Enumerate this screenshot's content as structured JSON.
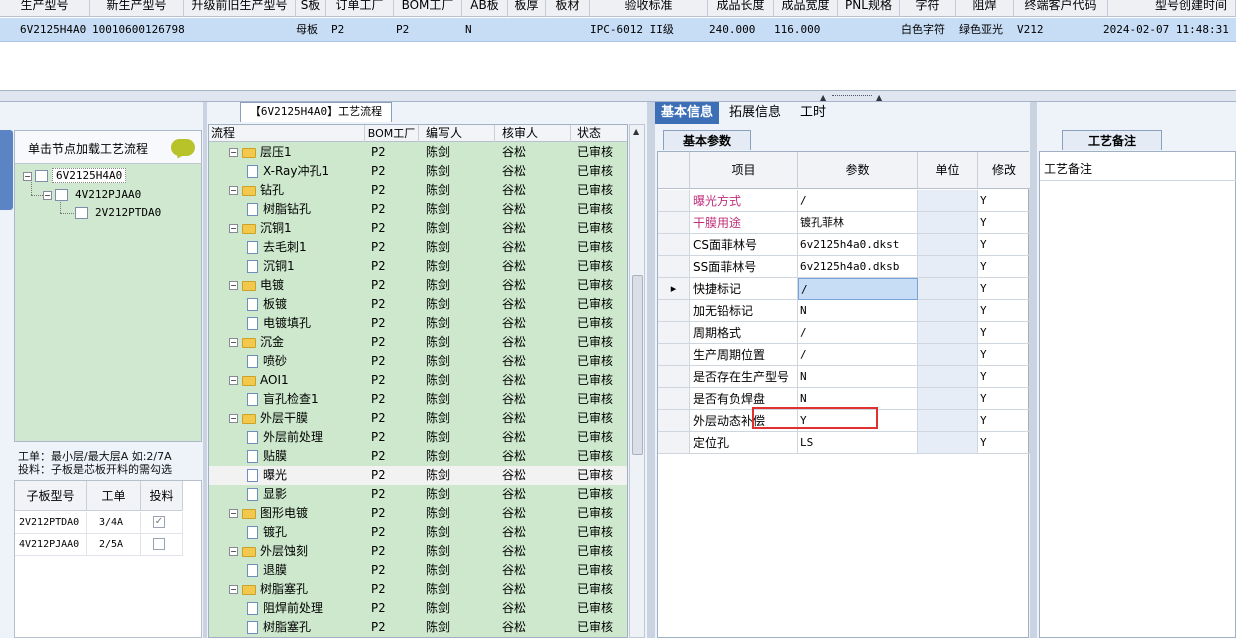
{
  "top_grid": {
    "headers": [
      "生产型号",
      "新生产型号",
      "升级前旧生产型号",
      "S板",
      "订单工厂",
      "BOM工厂",
      "AB板",
      "板厚",
      "板材",
      "验收标准",
      "成品长度",
      "成品宽度",
      "PNL规格",
      "字符",
      "阻焊",
      "终端客户代码",
      "型号创建时间"
    ],
    "row": {
      "prod_model": "6V2125H4A0",
      "new_model": "10010600126798",
      "board_type": "母板",
      "order_factory": "P2",
      "bom_factory": "P2",
      "ab": "N",
      "standard": "IPC-6012 II级",
      "length": "240.000",
      "width": "116.000",
      "char": "白色字符",
      "solder": "绿色亚光",
      "client_code": "V212",
      "created": "2024-02-07 11:48:31"
    }
  },
  "left": {
    "tree_header": "单击节点加载工艺流程",
    "tree": [
      "6V2125H4A0",
      "4V212PJAA0",
      "2V212PTDA0"
    ],
    "note_line1": "工单：最小层/最大层A 如:2/7A",
    "note_line2": "投料：子板是芯板开料的需勾选",
    "sub_headers": [
      "子板型号",
      "工单",
      "投料"
    ],
    "sub_rows": [
      {
        "model": "2V212PTDA0",
        "order": "3/4A",
        "checked": "✓"
      },
      {
        "model": "4V212PJAA0",
        "order": "2/5A",
        "checked": ""
      }
    ]
  },
  "center": {
    "title": "【6V2125H4A0】工艺流程",
    "headers": [
      "流程",
      "BOM工厂",
      "编写人",
      "核审人",
      "状态"
    ],
    "rows": [
      {
        "name": "层压1",
        "level": 0,
        "f": "P2",
        "w": "陈剑",
        "r": "谷松",
        "s": "已审核"
      },
      {
        "name": "X-Ray冲孔1",
        "level": 1,
        "f": "P2",
        "w": "陈剑",
        "r": "谷松",
        "s": "已审核"
      },
      {
        "name": "钻孔",
        "level": 0,
        "f": "P2",
        "w": "陈剑",
        "r": "谷松",
        "s": "已审核"
      },
      {
        "name": "树脂钻孔",
        "level": 1,
        "f": "P2",
        "w": "陈剑",
        "r": "谷松",
        "s": "已审核"
      },
      {
        "name": "沉铜1",
        "level": 0,
        "f": "P2",
        "w": "陈剑",
        "r": "谷松",
        "s": "已审核"
      },
      {
        "name": "去毛刺1",
        "level": 1,
        "f": "P2",
        "w": "陈剑",
        "r": "谷松",
        "s": "已审核"
      },
      {
        "name": "沉铜1",
        "level": 1,
        "f": "P2",
        "w": "陈剑",
        "r": "谷松",
        "s": "已审核"
      },
      {
        "name": "电镀",
        "level": 0,
        "f": "P2",
        "w": "陈剑",
        "r": "谷松",
        "s": "已审核"
      },
      {
        "name": "板镀",
        "level": 1,
        "f": "P2",
        "w": "陈剑",
        "r": "谷松",
        "s": "已审核"
      },
      {
        "name": "电镀填孔",
        "level": 1,
        "f": "P2",
        "w": "陈剑",
        "r": "谷松",
        "s": "已审核"
      },
      {
        "name": "沉金",
        "level": 0,
        "f": "P2",
        "w": "陈剑",
        "r": "谷松",
        "s": "已审核"
      },
      {
        "name": "喷砂",
        "level": 1,
        "f": "P2",
        "w": "陈剑",
        "r": "谷松",
        "s": "已审核"
      },
      {
        "name": "AOI1",
        "level": 0,
        "f": "P2",
        "w": "陈剑",
        "r": "谷松",
        "s": "已审核"
      },
      {
        "name": "盲孔检查1",
        "level": 1,
        "f": "P2",
        "w": "陈剑",
        "r": "谷松",
        "s": "已审核"
      },
      {
        "name": "外层干膜",
        "level": 0,
        "f": "P2",
        "w": "陈剑",
        "r": "谷松",
        "s": "已审核"
      },
      {
        "name": "外层前处理",
        "level": 1,
        "f": "P2",
        "w": "陈剑",
        "r": "谷松",
        "s": "已审核"
      },
      {
        "name": "贴膜",
        "level": 1,
        "f": "P2",
        "w": "陈剑",
        "r": "谷松",
        "s": "已审核"
      },
      {
        "name": "曝光",
        "level": 1,
        "f": "P2",
        "w": "陈剑",
        "r": "谷松",
        "s": "已审核",
        "hl": true
      },
      {
        "name": "显影",
        "level": 1,
        "f": "P2",
        "w": "陈剑",
        "r": "谷松",
        "s": "已审核"
      },
      {
        "name": "图形电镀",
        "level": 0,
        "f": "P2",
        "w": "陈剑",
        "r": "谷松",
        "s": "已审核"
      },
      {
        "name": "镀孔",
        "level": 1,
        "f": "P2",
        "w": "陈剑",
        "r": "谷松",
        "s": "已审核"
      },
      {
        "name": "外层蚀刻",
        "level": 0,
        "f": "P2",
        "w": "陈剑",
        "r": "谷松",
        "s": "已审核"
      },
      {
        "name": "退膜",
        "level": 1,
        "f": "P2",
        "w": "陈剑",
        "r": "谷松",
        "s": "已审核"
      },
      {
        "name": "树脂塞孔",
        "level": 0,
        "f": "P2",
        "w": "陈剑",
        "r": "谷松",
        "s": "已审核"
      },
      {
        "name": "阻焊前处理",
        "level": 1,
        "f": "P2",
        "w": "陈剑",
        "r": "谷松",
        "s": "已审核"
      },
      {
        "name": "树脂塞孔",
        "level": 1,
        "f": "P2",
        "w": "陈剑",
        "r": "谷松",
        "s": "已审核"
      }
    ]
  },
  "right": {
    "tabs": [
      "基本信息",
      "拓展信息",
      "工时"
    ],
    "sub_tab": "基本参数",
    "headers": [
      "项目",
      "参数",
      "单位",
      "修改"
    ],
    "rows": [
      {
        "item": "曝光方式",
        "value": "/",
        "mod": "Y",
        "color": "#c0307a"
      },
      {
        "item": "干膜用途",
        "value": "镀孔菲林",
        "mod": "Y",
        "color": "#c0307a"
      },
      {
        "item": "CS面菲林号",
        "value": "6v2125h4a0.dkst",
        "mod": "Y",
        "color": "#000000"
      },
      {
        "item": "SS面菲林号",
        "value": "6v2125h4a0.dksb",
        "mod": "Y",
        "color": "#000000"
      },
      {
        "item": "快捷标记",
        "value": "/",
        "mod": "Y",
        "color": "#000000",
        "current": true
      },
      {
        "item": "加无铅标记",
        "value": "N",
        "mod": "Y",
        "color": "#000000"
      },
      {
        "item": "周期格式",
        "value": "/",
        "mod": "Y",
        "color": "#000000"
      },
      {
        "item": "生产周期位置",
        "value": "/",
        "mod": "Y",
        "color": "#000000"
      },
      {
        "item": "是否存在生产型号",
        "value": "N",
        "mod": "Y",
        "color": "#000000"
      },
      {
        "item": "是否有负焊盘",
        "value": "N",
        "mod": "Y",
        "color": "#000000"
      },
      {
        "item": "外层动态补偿",
        "value": "Y",
        "mod": "Y",
        "color": "#000000"
      },
      {
        "item": "定位孔",
        "value": "LS",
        "mod": "Y",
        "color": "#000000"
      }
    ]
  },
  "notes": {
    "tab": "工艺备注",
    "label": "工艺备注"
  }
}
